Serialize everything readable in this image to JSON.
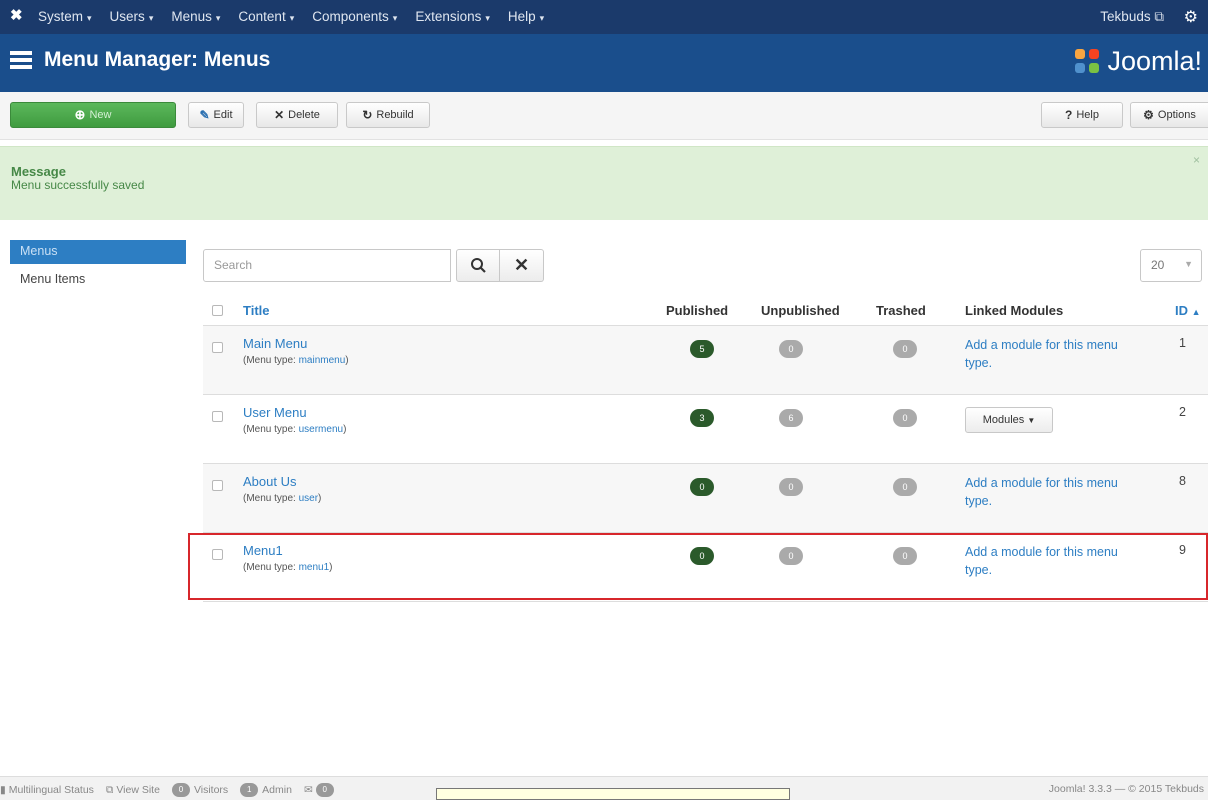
{
  "topnav": {
    "items": [
      {
        "label": "System"
      },
      {
        "label": "Users"
      },
      {
        "label": "Menus"
      },
      {
        "label": "Content"
      },
      {
        "label": "Components"
      },
      {
        "label": "Extensions"
      },
      {
        "label": "Help"
      }
    ],
    "user": "Tekbuds",
    "user_icon": "external-link-icon",
    "settings_icon": "gear-icon"
  },
  "header": {
    "title": "Menu Manager: Menus",
    "brand": "Joomla!"
  },
  "toolbar": {
    "new_label": "New",
    "edit_label": "Edit",
    "delete_label": "Delete",
    "rebuild_label": "Rebuild",
    "help_label": "Help",
    "options_label": "Options"
  },
  "message": {
    "heading": "Message",
    "text": "Menu successfully saved",
    "close": "×"
  },
  "sidebar": {
    "items": [
      {
        "label": "Menus",
        "active": true
      },
      {
        "label": "Menu Items",
        "active": false
      }
    ]
  },
  "filters": {
    "search_placeholder": "Search",
    "limit": "20"
  },
  "table": {
    "columns": {
      "title": "Title",
      "published": "Published",
      "unpublished": "Unpublished",
      "trashed": "Trashed",
      "linked_modules": "Linked Modules",
      "id": "ID"
    },
    "rows": [
      {
        "title": "Main Menu",
        "type_prefix": "(Menu type: ",
        "type": "mainmenu",
        "type_suffix": ")",
        "published": "5",
        "unpublished": "0",
        "trashed": "0",
        "linked": "Add a module for this menu type.",
        "modules_button": "",
        "id": "1"
      },
      {
        "title": "User Menu",
        "type_prefix": "(Menu type: ",
        "type": "usermenu",
        "type_suffix": ")",
        "published": "3",
        "unpublished": "6",
        "trashed": "0",
        "linked": "",
        "modules_button": "Modules",
        "id": "2"
      },
      {
        "title": "About Us",
        "type_prefix": "(Menu type: ",
        "type": "user",
        "type_suffix": ")",
        "published": "0",
        "unpublished": "0",
        "trashed": "0",
        "linked": "Add a module for this menu type.",
        "modules_button": "",
        "id": "8"
      },
      {
        "title": "Menu1",
        "type_prefix": "(Menu type: ",
        "type": "menu1",
        "type_suffix": ")",
        "published": "0",
        "unpublished": "0",
        "trashed": "0",
        "linked": "Add a module for this menu type.",
        "modules_button": "",
        "id": "9"
      }
    ]
  },
  "statusbar": {
    "multilingual": "Multilingual Status",
    "view_site": "View Site",
    "visitors_count": "0",
    "visitors": "Visitors",
    "admin_count": "1",
    "admin": "Admin",
    "messages_count": "0",
    "version": "Joomla! 3.3.3 — © 2015 Tekbuds"
  }
}
